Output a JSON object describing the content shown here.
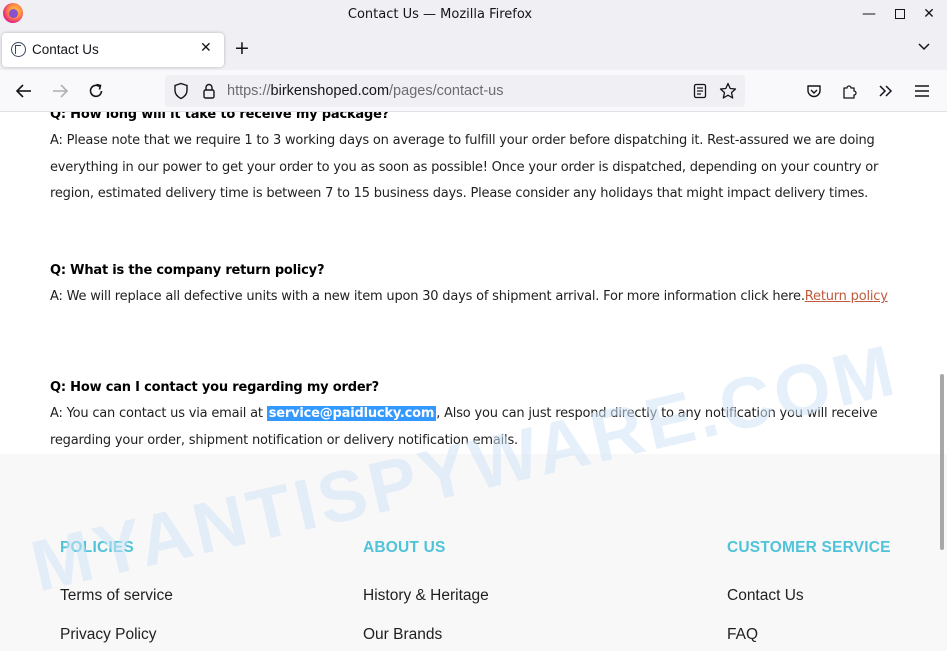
{
  "window": {
    "title": "Contact Us — Mozilla Firefox",
    "minimize": "—",
    "maximize": "",
    "close": "✕"
  },
  "tabs": [
    {
      "label": "Contact Us",
      "close": "✕"
    }
  ],
  "new_tab": "+",
  "url": {
    "scheme": "https://",
    "host": "birkenshoped.com",
    "path": "/pages/contact-us"
  },
  "faq": [
    {
      "question": "Q: How long will it take to receive my package?",
      "answer": "A: Please note that we require 1 to 3 working days on average to fulfill your order before dispatching it.  Rest-assured we are doing everything in our power to get your order to you as soon as possible!  Once your order is dispatched, depending on your country or region, estimated delivery time is between 7 to 15 business days.  Please consider any holidays that might impact delivery times."
    },
    {
      "question": "Q: What is the company return policy?",
      "answer": "A: We will replace all defective units with a new item upon 30 days of shipment arrival.  For more information click here.",
      "link": "Return policy"
    },
    {
      "question": "Q: How can I contact you regarding my order?",
      "answer_before": "A: You can contact us via email at ",
      "email": "service@paidlucky.com",
      "answer_after": ", Also you can just respond directly to any notification you will receive regarding your order, shipment notification or delivery notification emails."
    }
  ],
  "footer": {
    "policies": {
      "heading": "POLICIES",
      "links": [
        "Terms of service",
        "Privacy Policy"
      ]
    },
    "about": {
      "heading": "ABOUT US",
      "links": [
        "History & Heritage",
        "Our Brands"
      ]
    },
    "service": {
      "heading": "CUSTOMER SERVICE",
      "links": [
        "Contact Us",
        "FAQ"
      ]
    }
  },
  "watermark": "MYANTISPYWARE.COM",
  "colors": {
    "accent_heading": "#4fc3d9",
    "link": "#c05a3c",
    "selection": "#3399ff"
  },
  "icons": [
    "firefox-logo-icon",
    "site-favicon-icon",
    "back-arrow-icon",
    "forward-arrow-icon",
    "reload-icon",
    "shield-icon",
    "lock-icon",
    "reader-view-icon",
    "bookmark-star-icon",
    "pocket-icon",
    "extensions-icon",
    "overflow-chevron-icon",
    "hamburger-menu-icon",
    "tab-list-chevron-icon"
  ]
}
